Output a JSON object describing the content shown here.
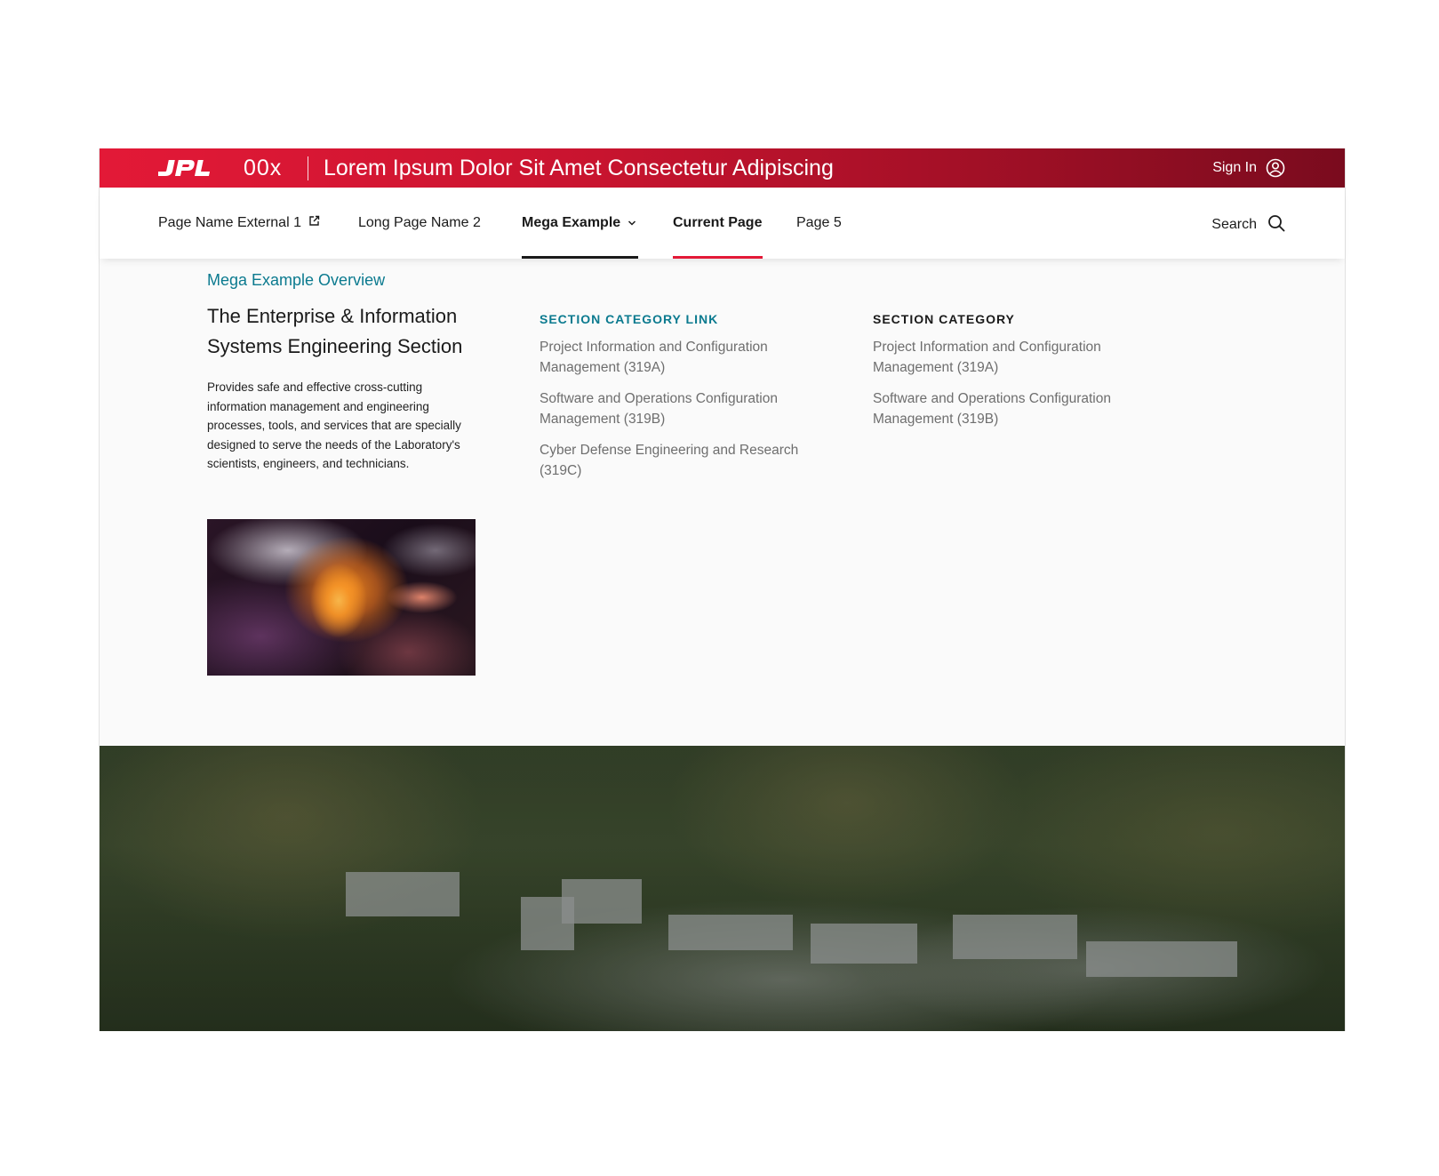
{
  "header": {
    "logo_text": "JPL",
    "site_code": "00x",
    "site_title": "Lorem Ipsum Dolor Sit Amet Consectetur Adipiscing",
    "signin_label": "Sign In"
  },
  "nav": {
    "items": [
      {
        "label": "Page Name External 1",
        "icon": "external-link-icon"
      },
      {
        "label": "Long Page Name 2"
      },
      {
        "label": "Mega Example",
        "icon": "chevron-down-icon",
        "state": "open"
      },
      {
        "label": "Current Page",
        "state": "current"
      },
      {
        "label": "Page 5"
      }
    ],
    "search_label": "Search"
  },
  "mega_menu": {
    "overview_link": "Mega Example Overview",
    "heading": "The Enterprise & Information Systems Engineering Section",
    "description": "Provides safe and effective cross-cutting information management and engineering processes, tools, and services that are specially designed to serve the needs of the Laboratory's scientists, engineers, and technicians.",
    "columns": [
      {
        "heading": "SECTION CATEGORY LINK",
        "links": [
          "Project Information and Configuration Management (319A)",
          "Software and Operations Configuration Management (319B)",
          "Cyber Defense Engineering and Research (319C)"
        ]
      },
      {
        "heading": "SECTION CATEGORY",
        "links": [
          "Project Information and Configuration Management (319A)",
          "Software and Operations Configuration Management (319B)"
        ]
      }
    ]
  },
  "colors": {
    "brand_red": "#e31937",
    "accent_teal": "#0b7a8f",
    "current_underline": "#e31937",
    "open_underline": "#1a1a1a"
  }
}
